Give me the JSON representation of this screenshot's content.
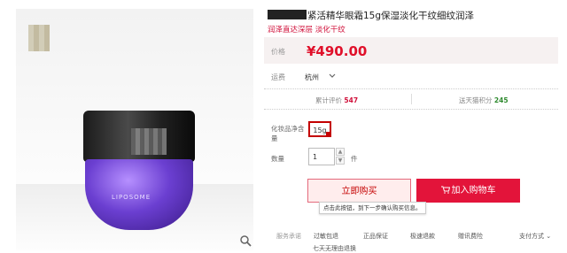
{
  "product": {
    "title_visible": "紧活精华眼霜15g保湿淡化干纹细纹润泽",
    "subtitle": "润泽直达深层 淡化干纹",
    "brand_mark": "LIPOSOME"
  },
  "price": {
    "label": "价格",
    "value": "¥490.00"
  },
  "shipping": {
    "label": "运费",
    "destination": "杭州"
  },
  "stats": {
    "reviews_label": "累计评价",
    "reviews_count": "547",
    "points_label": "送天猫积分",
    "points_value": "245"
  },
  "spec": {
    "label": "化妆品净含量",
    "selected": "15g"
  },
  "quantity": {
    "label": "数量",
    "value": "1",
    "unit": "件"
  },
  "actions": {
    "buy_now": "立即购买",
    "add_to_cart": "加入购物车",
    "tooltip": "点击此按钮，到下一步确认购买信息。"
  },
  "service": {
    "label": "服务承诺",
    "items": [
      "过敏包退",
      "正品保证",
      "极速退款",
      "赠讯费险"
    ],
    "sub_item": "七天无理由退换",
    "payment_label": "支付方式"
  },
  "colors": {
    "accent": "#e3143a",
    "price": "#e0102a",
    "points": "#2f8a2f"
  },
  "icons": [
    "zoom-icon",
    "dropdown-arrow-icon",
    "cart-icon",
    "chevron-down-icon"
  ]
}
